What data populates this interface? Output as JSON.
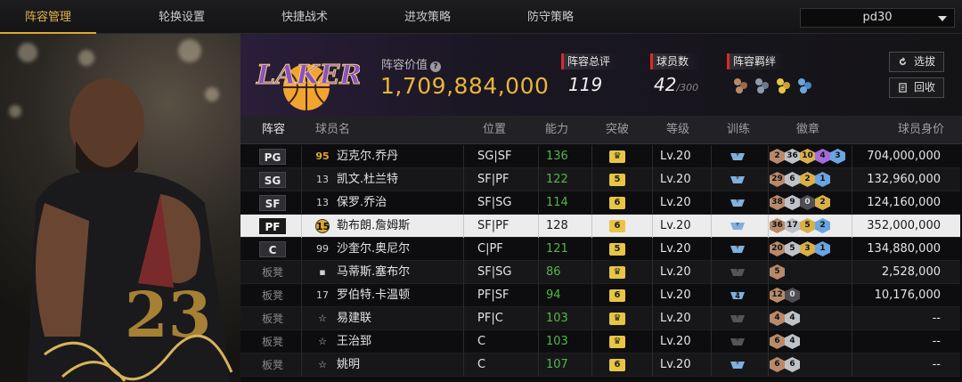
{
  "tabs": [
    {
      "label": "阵容管理",
      "active": true
    },
    {
      "label": "轮换设置",
      "active": false
    },
    {
      "label": "快捷战术",
      "active": false
    },
    {
      "label": "进攻策略",
      "active": false
    },
    {
      "label": "防守策略",
      "active": false
    }
  ],
  "account_select": {
    "value": "pd30"
  },
  "team": {
    "value_label": "阵容价值",
    "value": "1,709,884,000",
    "overall_label": "阵容总评",
    "overall": "119",
    "count_label": "球员数",
    "count": "42",
    "count_max": "/300",
    "bond_label": "阵容羁绊",
    "select_button": "选拔",
    "recycle_button": "回收"
  },
  "table": {
    "headers": {
      "lineup": "阵容",
      "name": "球员名",
      "position": "位置",
      "ability": "能力",
      "breakthrough": "突破",
      "level": "等级",
      "training": "训练",
      "badges": "徽章",
      "value": "球员身价"
    },
    "rows": [
      {
        "slot": "PG",
        "num": "95",
        "name": "迈克尔.乔丹",
        "position": "SG|SF",
        "ability": "136",
        "breakthrough": "crown",
        "level": "Lv.20",
        "badges": [
          [
            "2",
            "bronze"
          ],
          [
            "36",
            "silver"
          ],
          [
            "10",
            "gold"
          ],
          [
            "4",
            "purple"
          ],
          [
            "3",
            "blue"
          ]
        ],
        "value": "704,000,000"
      },
      {
        "slot": "SG",
        "num": "13",
        "name": "凯文.杜兰特",
        "position": "SF|PF",
        "ability": "122",
        "breakthrough": "5",
        "level": "Lv.20",
        "badges": [
          [
            "29",
            "bronze"
          ],
          [
            "6",
            "silver"
          ],
          [
            "2",
            "gold"
          ],
          [
            "1",
            "blue"
          ]
        ],
        "value": "132,960,000"
      },
      {
        "slot": "SF",
        "num": "13",
        "name": "保罗.乔治",
        "position": "SF|SG",
        "ability": "114",
        "breakthrough": "6",
        "level": "Lv.20",
        "badges": [
          [
            "38",
            "bronze"
          ],
          [
            "9",
            "silver"
          ],
          [
            "0",
            "dark"
          ],
          [
            "2",
            "gold"
          ]
        ],
        "value": "124,160,000"
      },
      {
        "slot": "PF",
        "num": "15",
        "name": "勒布朗.詹姆斯",
        "position": "SF|PF",
        "ability": "128",
        "breakthrough": "6",
        "level": "Lv.20",
        "badges": [
          [
            "36",
            "bronze"
          ],
          [
            "17",
            "silver"
          ],
          [
            "5",
            "gold"
          ],
          [
            "2",
            "blue"
          ]
        ],
        "value": "352,000,000"
      },
      {
        "slot": "C",
        "num": "99",
        "name": "沙奎尔.奥尼尔",
        "position": "C|PF",
        "ability": "121",
        "breakthrough": "5",
        "level": "Lv.20",
        "badges": [
          [
            "20",
            "bronze"
          ],
          [
            "5",
            "silver"
          ],
          [
            "3",
            "gold"
          ],
          [
            "1",
            "blue"
          ]
        ],
        "value": "134,880,000"
      },
      {
        "slot": "板凳",
        "num": "",
        "name": "马蒂斯.塞布尔",
        "position": "SF|SG",
        "ability": "86",
        "breakthrough": "crown",
        "level": "Lv.20",
        "badges": [
          [
            "5",
            "bronze"
          ]
        ],
        "value": "2,528,000"
      },
      {
        "slot": "板凳",
        "num": "17",
        "name": "罗伯特.卡温顿",
        "position": "PF|SF",
        "ability": "94",
        "breakthrough": "6",
        "level": "Lv.20",
        "train_level": "4",
        "badges": [
          [
            "12",
            "bronze"
          ],
          [
            "0",
            "dark"
          ]
        ],
        "value": "10,176,000"
      },
      {
        "slot": "板凳",
        "num": "",
        "name": "易建联",
        "position": "PF|C",
        "ability": "103",
        "breakthrough": "crown",
        "level": "Lv.20",
        "badges": [
          [
            "4",
            "bronze"
          ],
          [
            "4",
            "silver"
          ]
        ],
        "value": "--"
      },
      {
        "slot": "板凳",
        "num": "",
        "name": "王治郅",
        "position": "C",
        "ability": "103",
        "breakthrough": "crown",
        "level": "Lv.20",
        "badges": [
          [
            "6",
            "bronze"
          ],
          [
            "4",
            "silver"
          ]
        ],
        "value": "--"
      },
      {
        "slot": "板凳",
        "num": "",
        "name": "姚明",
        "position": "C",
        "ability": "107",
        "breakthrough": "6",
        "level": "Lv.20",
        "badges": [
          [
            "6",
            "bronze"
          ],
          [
            "6",
            "silver"
          ]
        ],
        "value": "--"
      }
    ]
  },
  "colors": {
    "accent": "#e2a829",
    "ability_green": "#53b648",
    "stat_marker": "#d92a2a"
  }
}
